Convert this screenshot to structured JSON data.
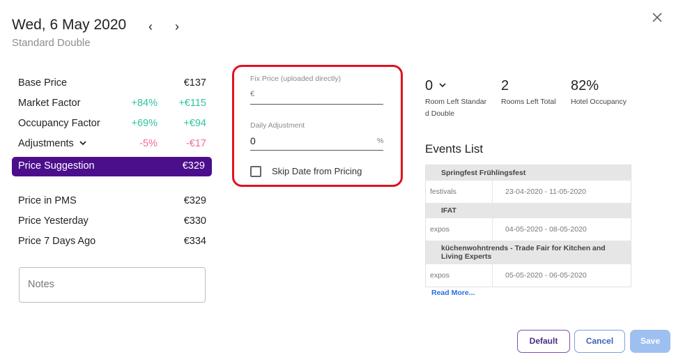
{
  "header": {
    "date": "Wed, 6 May 2020",
    "room_type": "Standard Double",
    "prev_glyph": "‹",
    "next_glyph": "›"
  },
  "prices": {
    "base": {
      "label": "Base Price",
      "value": "€137"
    },
    "market": {
      "label": "Market Factor",
      "pct": "+84%",
      "value": "+€115"
    },
    "occupancy": {
      "label": "Occupancy Factor",
      "pct": "+69%",
      "value": "+€94"
    },
    "adjustments": {
      "label": "Adjustments",
      "pct": "-5%",
      "value": "-€17"
    },
    "suggestion": {
      "label": "Price Suggestion",
      "value": "€329"
    },
    "pms": {
      "label": "Price in PMS",
      "value": "€329"
    },
    "yesterday": {
      "label": "Price Yesterday",
      "value": "€330"
    },
    "seven_days": {
      "label": "Price 7 Days Ago",
      "value": "€334"
    }
  },
  "notes": {
    "placeholder": "Notes"
  },
  "fix_price": {
    "label": "Fix Price (uploaded directly)",
    "prefix": "€",
    "value": ""
  },
  "daily_adjustment": {
    "label": "Daily Adjustment",
    "value": "0",
    "suffix": "%"
  },
  "skip_date": {
    "label": "Skip Date from Pricing",
    "checked": false
  },
  "stats": {
    "room_left": {
      "value": "0",
      "label1": "Room Left Standar",
      "label2": "d Double"
    },
    "rooms_total": {
      "value": "2",
      "label": "Rooms Left Total"
    },
    "occupancy": {
      "value": "82%",
      "label": "Hotel Occupancy"
    }
  },
  "events": {
    "title": "Events List",
    "items": [
      {
        "name": "Springfest Frühlingsfest",
        "category": "festivals",
        "dates": "23-04-2020 - 11-05-2020"
      },
      {
        "name": "IFAT",
        "category": "expos",
        "dates": "04-05-2020 - 08-05-2020"
      },
      {
        "name": "küchenwohntrends - Trade Fair for Kitchen and Living Experts",
        "category": "expos",
        "dates": "05-05-2020 - 06-05-2020"
      }
    ],
    "read_more": "Read More..."
  },
  "buttons": {
    "default": "Default",
    "cancel": "Cancel",
    "save": "Save"
  },
  "colors": {
    "accent": "#4b0f8c",
    "positive": "#2fc4a0",
    "negative": "#f06aa0",
    "highlight": "#e0121f",
    "link": "#2a6fdb"
  }
}
